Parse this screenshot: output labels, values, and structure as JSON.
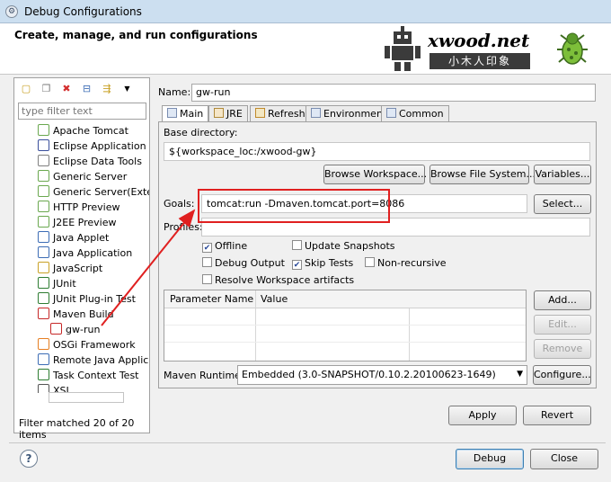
{
  "window": {
    "title": "Debug Configurations"
  },
  "header": {
    "text": "Create, manage, and run configurations",
    "logo_text": "xwood.net",
    "logo_cn": "小木人印象"
  },
  "left": {
    "filter_placeholder": "type filter text",
    "items": [
      {
        "label": "Apache Tomcat",
        "icon": "tomcat-icon",
        "color": "#6aa84f"
      },
      {
        "label": "Eclipse Application",
        "icon": "eclipse-icon",
        "color": "#3a4f9c"
      },
      {
        "label": "Eclipse Data Tools",
        "icon": "data-tools-icon",
        "color": "#7f7f7f"
      },
      {
        "label": "Generic Server",
        "icon": "server-icon",
        "color": "#6aa84f"
      },
      {
        "label": "Generic Server(Extern",
        "icon": "server-icon",
        "color": "#6aa84f"
      },
      {
        "label": "HTTP Preview",
        "icon": "server-icon",
        "color": "#6aa84f"
      },
      {
        "label": "J2EE Preview",
        "icon": "server-icon",
        "color": "#6aa84f"
      },
      {
        "label": "Java Applet",
        "icon": "applet-icon",
        "color": "#3d6db5"
      },
      {
        "label": "Java Application",
        "icon": "java-app-icon",
        "color": "#3d6db5"
      },
      {
        "label": "JavaScript",
        "icon": "javascript-icon",
        "color": "#c9a227"
      },
      {
        "label": "JUnit",
        "icon": "junit-icon",
        "color": "#2e7d32"
      },
      {
        "label": "JUnit Plug-in Test",
        "icon": "junit-plugin-icon",
        "color": "#2e7d32"
      },
      {
        "label": "Maven Build",
        "icon": "maven-icon",
        "color": "#c62828"
      },
      {
        "label": "gw-run",
        "icon": "maven-icon",
        "color": "#c62828"
      },
      {
        "label": "OSGi Framework",
        "icon": "osgi-icon",
        "color": "#e67e22"
      },
      {
        "label": "Remote Java Applicat",
        "icon": "remote-java-icon",
        "color": "#3d6db5"
      },
      {
        "label": "Task Context Test",
        "icon": "task-icon",
        "color": "#2e7d32"
      },
      {
        "label": "XSL",
        "icon": "xsl-icon",
        "color": "#555555"
      }
    ],
    "status": "Filter matched 20 of 20 items"
  },
  "form": {
    "name_label": "Name:",
    "name_value": "gw-run",
    "tabs": [
      "Main",
      "JRE",
      "Refresh",
      "Environment",
      "Common"
    ],
    "base_dir_label": "Base directory:",
    "base_dir_value": "${workspace_loc:/xwood-gw}",
    "browse_workspace": "Browse Workspace...",
    "browse_fs": "Browse File System...",
    "variables": "Variables...",
    "goals_label": "Goals:",
    "goals_value": "tomcat:run -Dmaven.tomcat.port=8086",
    "select": "Select...",
    "profiles_label": "Profiles:",
    "profiles_value": "",
    "checkboxes": {
      "offline": {
        "label": "Offline",
        "checked": true
      },
      "update_snapshots": {
        "label": "Update Snapshots",
        "checked": false
      },
      "debug_output": {
        "label": "Debug Output",
        "checked": false
      },
      "skip_tests": {
        "label": "Skip Tests",
        "checked": true
      },
      "non_recursive": {
        "label": "Non-recursive",
        "checked": false
      },
      "resolve_workspace": {
        "label": "Resolve Workspace artifacts",
        "checked": false
      }
    },
    "param_headers": [
      "Parameter Name",
      "Value"
    ],
    "add": "Add...",
    "edit": "Edit...",
    "remove": "Remove",
    "runtime_label": "Maven Runtime:",
    "runtime_value": "Embedded (3.0-SNAPSHOT/0.10.2.20100623-1649)",
    "configure": "Configure...",
    "apply": "Apply",
    "revert": "Revert"
  },
  "footer": {
    "debug": "Debug",
    "close": "Close"
  },
  "colors": {
    "annotation": "#e02020",
    "titlebar": "#ccdff0"
  }
}
